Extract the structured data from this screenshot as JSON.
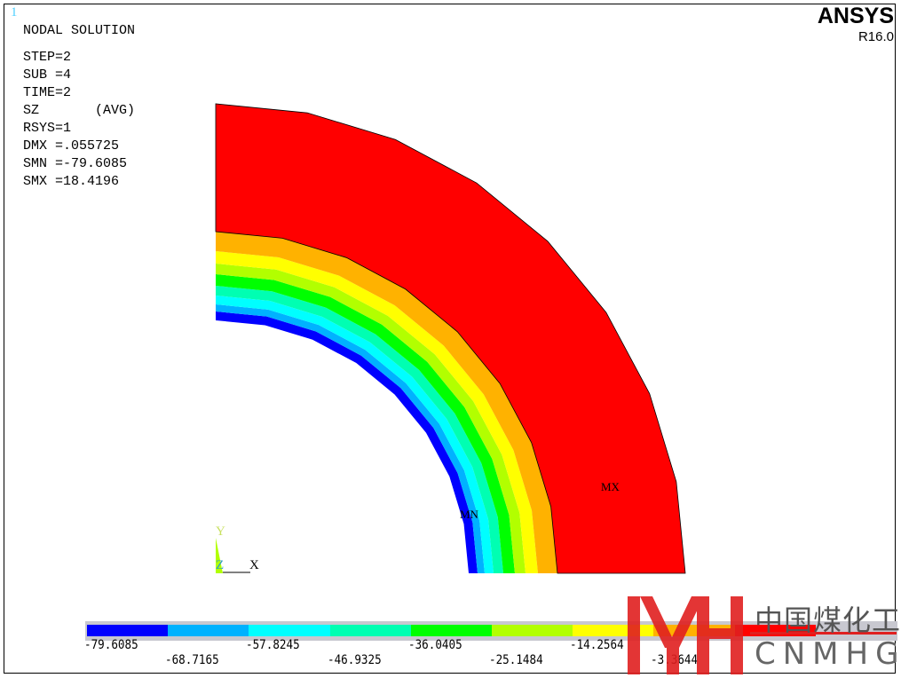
{
  "window_number": "1",
  "brand": {
    "name": "ANSYS",
    "version": "R16.0"
  },
  "info": {
    "title": "NODAL SOLUTION",
    "lines": [
      "STEP=2",
      "SUB =4",
      "TIME=2",
      "SZ       (AVG)",
      "RSYS=1",
      "DMX =.055725",
      "SMN =-79.6085",
      "SMX =18.4196"
    ]
  },
  "markers": {
    "min": "MN",
    "max": "MX"
  },
  "triad": {
    "y": "Y",
    "z": "Z",
    "x": "X"
  },
  "legend": {
    "colors": [
      "#0000ff",
      "#00b2ff",
      "#00ffff",
      "#00ffb2",
      "#00ff00",
      "#b2ff00",
      "#ffff00",
      "#ffb200",
      "#ff0000"
    ],
    "labels": [
      "-79.6085",
      "-68.7165",
      "-57.8245",
      "-46.9325",
      "-36.0405",
      "-25.1484",
      "-14.2564",
      "-3.3644"
    ]
  },
  "watermark": {
    "logo": "MH",
    "cn": "中国煤化工",
    "en": "CNMHG"
  }
}
